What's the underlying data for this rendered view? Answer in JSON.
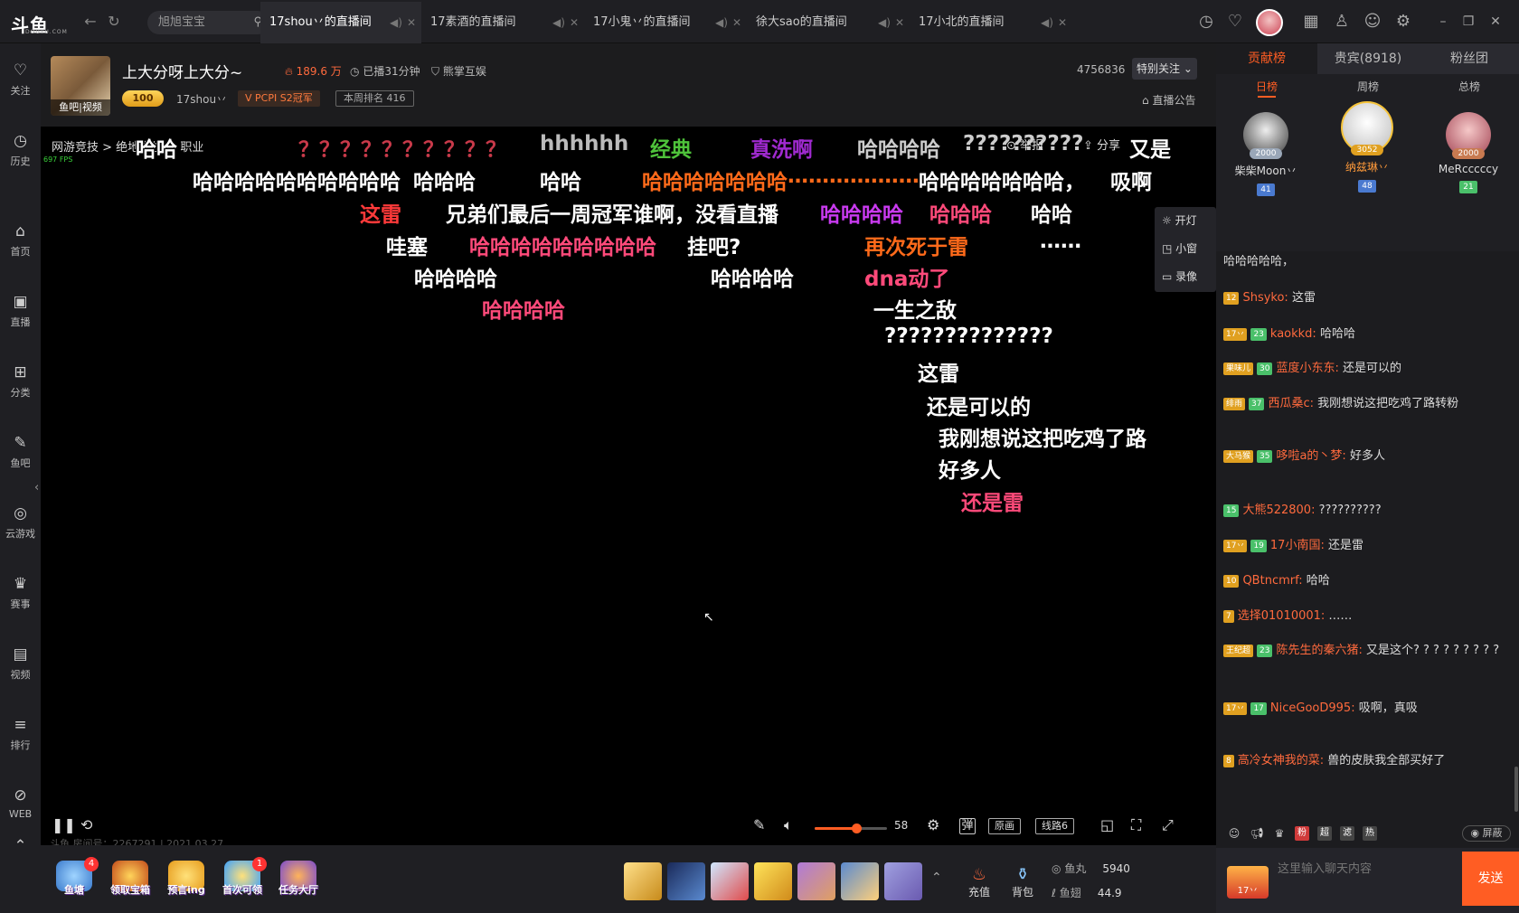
{
  "app": {
    "logo": "斗鱼",
    "logo_sub": "DOUYU.COM"
  },
  "nav": {
    "back": "←",
    "refresh": "↻"
  },
  "search": {
    "text": "旭旭宝宝"
  },
  "tabs": [
    {
      "title": "17shou丷的直播间"
    },
    {
      "title": "17素酒的直播间"
    },
    {
      "title": "17小鬼丷的直播间"
    },
    {
      "title": "徐大sao的直播间"
    },
    {
      "title": "17小北的直播间"
    }
  ],
  "topicons": [
    "clock-icon",
    "heart-icon",
    "calendar-icon",
    "shirt-icon",
    "chat-icon",
    "settings-icon"
  ],
  "window": {
    "min": "–",
    "max": "❐",
    "close": "✕"
  },
  "sidebar": [
    {
      "label": "关注",
      "icon": "♡"
    },
    {
      "label": "历史",
      "icon": "◷"
    },
    {
      "label": "首页",
      "icon": "⌂"
    },
    {
      "label": "直播",
      "icon": "▣"
    },
    {
      "label": "分类",
      "icon": "⊞"
    },
    {
      "label": "鱼吧",
      "icon": "✎"
    },
    {
      "label": "云游戏",
      "icon": "◎"
    },
    {
      "label": "赛事",
      "icon": "♛"
    },
    {
      "label": "视频",
      "icon": "▤"
    },
    {
      "label": "排行",
      "icon": "≡"
    },
    {
      "label": "WEB",
      "icon": "⊘"
    }
  ],
  "header": {
    "avatar_footer": "鱼吧|视频",
    "title": "上大分呀上大分~",
    "hot": "189.6 万",
    "duration": "已播31分钟",
    "category": "熊掌互娱",
    "level": "100",
    "anchor": "17shou丷",
    "honor": "PCPI S2冠军",
    "rank": "本周排名 416",
    "fans": "4756836",
    "follow": "特别关注",
    "announce": "直播公告"
  },
  "player": {
    "crumb": "网游竞技  >  绝地求生  >  职业",
    "fps": "697 FPS",
    "report": "举报",
    "share": "分享",
    "float_menu": [
      "开灯",
      "小窗",
      "录像"
    ],
    "danmaku": [
      {
        "t": "哈哈",
        "c": "#ffffff"
      },
      {
        "t": "？？？？？？？？？？",
        "c": "#c93a4a"
      },
      {
        "t": "hhhhhh",
        "c": "#bbbbbb"
      },
      {
        "t": "经典",
        "c": "#4ec23a"
      },
      {
        "t": "真洗啊",
        "c": "#a02ad0"
      },
      {
        "t": "哈哈哈哈",
        "c": "#cccccc"
      },
      {
        "t": "??????????",
        "c": "#cccccc"
      },
      {
        "t": "又是",
        "c": "#ffffff"
      },
      {
        "t": "哈哈哈哈哈哈哈哈哈哈",
        "c": "#ffffff"
      },
      {
        "t": "哈哈哈",
        "c": "#ffffff"
      },
      {
        "t": "哈哈",
        "c": "#ffffff"
      },
      {
        "t": "哈哈哈哈哈哈哈",
        "c": "#ff6a1a"
      },
      {
        "t": "…………………",
        "c": "#ff6a1a"
      },
      {
        "t": "哈哈哈哈哈哈哈，",
        "c": "#ffffff"
      },
      {
        "t": "吸啊",
        "c": "#ffffff"
      },
      {
        "t": "这雷",
        "c": "#ff3a3a"
      },
      {
        "t": "兄弟们最后一周冠军谁啊，没看直播",
        "c": "#ffffff"
      },
      {
        "t": "哈哈哈哈",
        "c": "#c93af0"
      },
      {
        "t": "哈哈哈",
        "c": "#ff4a7a"
      },
      {
        "t": "哈哈",
        "c": "#ffffff"
      },
      {
        "t": "哇塞",
        "c": "#ffffff"
      },
      {
        "t": "哈哈哈哈哈哈哈哈哈",
        "c": "#ff4a7a"
      },
      {
        "t": "挂吧?",
        "c": "#ffffff"
      },
      {
        "t": "再次死于雷",
        "c": "#ff6a1a"
      },
      {
        "t": "……",
        "c": "#ffffff"
      },
      {
        "t": "哈哈哈哈",
        "c": "#ffffff"
      },
      {
        "t": "哈哈哈哈",
        "c": "#ffffff"
      },
      {
        "t": "dna动了",
        "c": "#ff4a7a"
      },
      {
        "t": "哈哈哈哈",
        "c": "#ff4a7a"
      },
      {
        "t": "一生之敌",
        "c": "#ffffff"
      },
      {
        "t": "??????????????",
        "c": "#ffffff"
      },
      {
        "t": "这雷",
        "c": "#ffffff"
      },
      {
        "t": "还是可以的",
        "c": "#ffffff"
      },
      {
        "t": "我刚想说这把吃鸡了路",
        "c": "#ffffff"
      },
      {
        "t": "好多人",
        "c": "#ffffff"
      },
      {
        "t": "还是雷",
        "c": "#ff4a7a"
      }
    ],
    "volume": 58,
    "volume_text": "58",
    "quality": "原画",
    "line": "线路6",
    "roomid": "斗鱼 房间号：2267291 | 2021.03.27"
  },
  "bottom": {
    "items": [
      {
        "label": "鱼塘",
        "badge": "4"
      },
      {
        "label": "领取宝箱"
      },
      {
        "label": "预言ing"
      },
      {
        "label": "首次可领",
        "badge": "1"
      },
      {
        "label": "任务大厅"
      }
    ],
    "recharge": "充值",
    "bag": "背包",
    "fishball_label": "鱼丸",
    "fishball": "5940",
    "fishfin_label": "鱼翅",
    "fishfin": "44.9"
  },
  "right": {
    "tabs": [
      "贡献榜",
      "贵宾(8918)",
      "粉丝团"
    ],
    "subtabs": [
      "日榜",
      "周榜",
      "总榜"
    ],
    "top3": [
      {
        "name": "柴柴Moon丷",
        "score": "2000",
        "badge": "41"
      },
      {
        "name": "纳兹琳丷",
        "score": "3052",
        "badge": "48"
      },
      {
        "name": "MeRcccccy",
        "score": "2000",
        "badge": "21"
      }
    ],
    "chat": [
      {
        "nick": "",
        "text": "哈哈哈哈哈，",
        "lvl": "",
        "fan": ""
      },
      {
        "nick": "Shsyko:",
        "text": " 这雷",
        "lvl": "12",
        "fan": ""
      },
      {
        "nick": "kaokkd:",
        "text": " 哈哈哈",
        "lvl": "17丷",
        "fan": "23"
      },
      {
        "nick": "蓝度小东东:",
        "text": " 还是可以的",
        "lvl": "果味儿",
        "fan": "30"
      },
      {
        "nick": "西瓜桑c:",
        "text": " 我刚想说这把吃鸡了路转粉",
        "lvl": "绯雨",
        "fan": "37"
      },
      {
        "nick": "哆啦a的丶梦:",
        "text": " 好多人",
        "lvl": "大马猴",
        "fan": "35"
      },
      {
        "nick": "大熊522800:",
        "text": " ??????????",
        "lvl": "",
        "fan": "15"
      },
      {
        "nick": "17小南国:",
        "text": " 还是雷",
        "lvl": "17丷",
        "fan": "19"
      },
      {
        "nick": "QBtncmrf:",
        "text": " 哈哈",
        "lvl": "10",
        "fan": ""
      },
      {
        "nick": "选择01010001:",
        "text": " ……",
        "lvl": "7",
        "fan": ""
      },
      {
        "nick": "陈先生的秦六猪:",
        "text": " 又是这个? ? ? ? ? ? ? ? ?",
        "lvl": "王纪超",
        "fan": "23"
      },
      {
        "nick": "NiceGooD995:",
        "text": " 吸啊，真吸",
        "lvl": "17丷",
        "fan": "17"
      },
      {
        "nick": "高冷女神我的菜:",
        "text": " 兽的皮肤我全部买好了",
        "lvl": "8",
        "fan": ""
      }
    ],
    "tools": [
      "粉",
      "超",
      "滤",
      "热"
    ],
    "shield": "屏蔽",
    "user_level": "17丷",
    "input_placeholder": "这里输入聊天内容",
    "send": "发送"
  }
}
